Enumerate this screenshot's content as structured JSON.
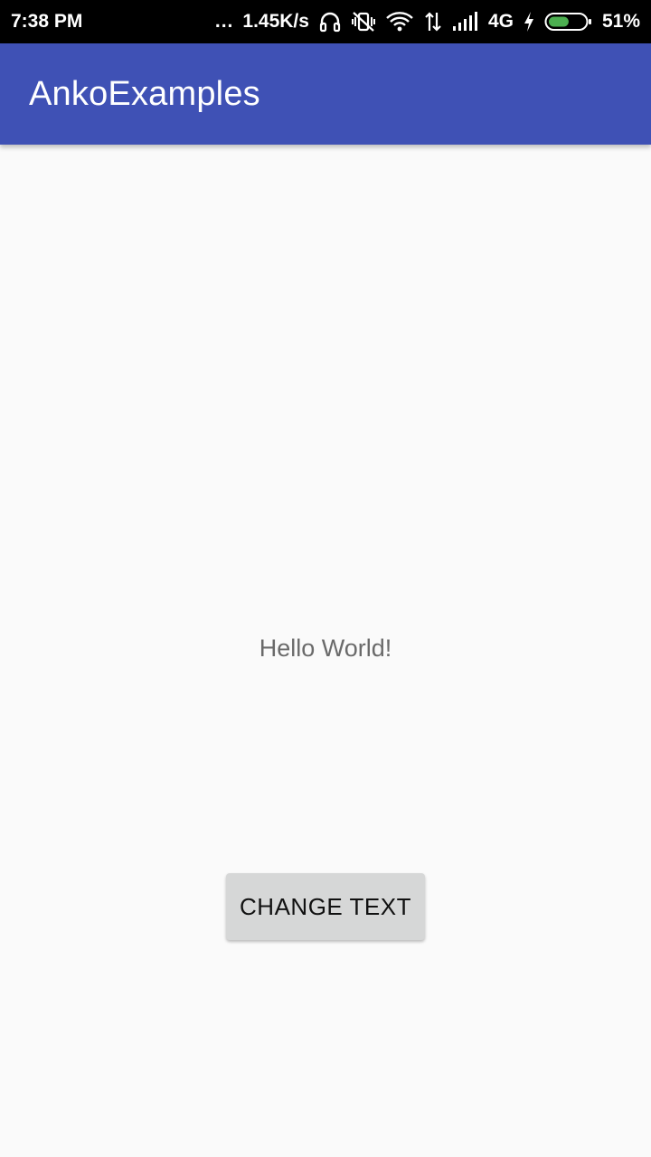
{
  "status_bar": {
    "time": "7:38 PM",
    "dots": "...",
    "speed": "1.45K/s",
    "network": "4G",
    "battery": "51%",
    "icons": [
      "headphones-icon",
      "vibrate-off-icon",
      "wifi-icon",
      "data-arrows-icon",
      "signal-icon",
      "charging-icon",
      "battery-icon"
    ],
    "battery_level": 0.51,
    "battery_color": "#4caf50"
  },
  "app_bar": {
    "title": "AnkoExamples",
    "color": "#3f51b5"
  },
  "content": {
    "hello_text": "Hello World!",
    "button_label": "CHANGE TEXT"
  }
}
